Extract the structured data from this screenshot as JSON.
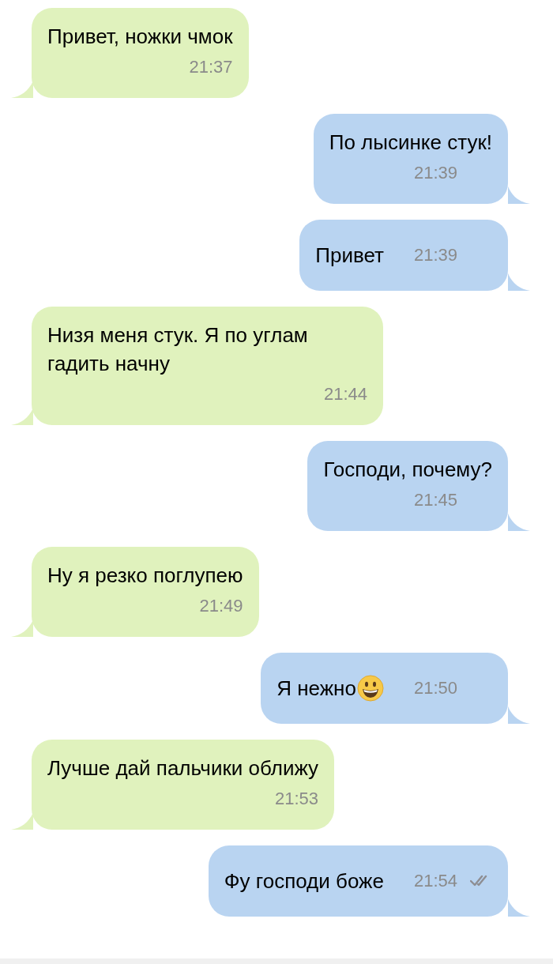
{
  "messages": [
    {
      "kind": "incoming",
      "text": "Привет,  ножки чмок",
      "time": "21:37"
    },
    {
      "kind": "outgoing",
      "text": "По лысинке стук!",
      "time": "21:39"
    },
    {
      "kind": "compact",
      "text": "Привет",
      "time": "21:39"
    },
    {
      "kind": "incoming",
      "text": "Низя меня стук. Я по углам гадить начну",
      "time": "21:44"
    },
    {
      "kind": "outgoing",
      "text": "Господи, почему?",
      "time": "21:45"
    },
    {
      "kind": "incoming",
      "text": "Ну я резко поглупею",
      "time": "21:49"
    },
    {
      "kind": "compact",
      "text": "Я нежно",
      "emoji": true,
      "time": "21:50"
    },
    {
      "kind": "incoming",
      "text": "Лучше дай пальчики оближу",
      "time": "21:53"
    },
    {
      "kind": "compact",
      "text": "Фу господи боже",
      "time": "21:54",
      "read": true
    }
  ]
}
